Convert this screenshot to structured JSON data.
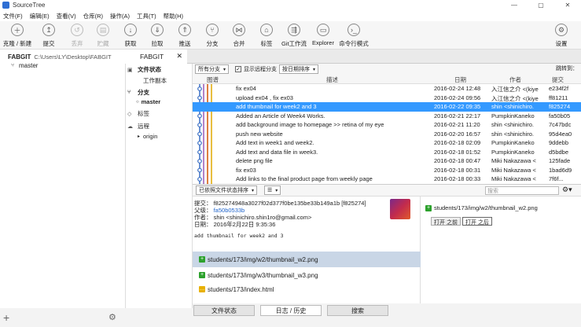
{
  "window": {
    "title": "SourceTree",
    "minimize": "—",
    "maximize": "▢",
    "close": "✕"
  },
  "menu": [
    "文件(F)",
    "编辑(E)",
    "查看(V)",
    "仓库(R)",
    "操作(A)",
    "工具(T)",
    "帮助(H)"
  ],
  "toolbar": {
    "clone": "克隆 / 新建",
    "commit": "提交",
    "discard": "丢弃",
    "stash": "贮藏",
    "fetch": "获取",
    "pull": "拉取",
    "push": "推送",
    "branch": "分支",
    "merge": "合并",
    "tag": "标签",
    "gitflow": "Git工作流",
    "explorer": "Explorer",
    "terminal": "命令行模式",
    "settings": "设置"
  },
  "repo": {
    "name": "FABGIT",
    "path": "C:\\Users\\LY\\Desktop\\FABGIT",
    "branch": "master"
  },
  "tab": {
    "label": "FABGIT",
    "close": "✕"
  },
  "nav": {
    "file_status": "文件状态",
    "working_copy": "工作副本",
    "branches": "分支",
    "master": "master",
    "tags": "标签",
    "remotes": "远程",
    "origin": "origin"
  },
  "filters": {
    "branches": "所有分支",
    "show_remote": "显示远程分支",
    "sort": "按日期排序",
    "jump_to": "跳转到："
  },
  "columns": {
    "graph": "图谱",
    "description": "描述",
    "date": "日期",
    "author": "作者",
    "commit": "提交"
  },
  "commits": [
    {
      "desc": "fix ex04",
      "date": "2016-02-24 12:48",
      "author": "入江信之介 <(kiye",
      "hash": "e234f2f"
    },
    {
      "desc": "upload ex04 , fix ex03",
      "date": "2016-02-24 09:56",
      "author": "入江信之介 <(kiye",
      "hash": "ff81211"
    },
    {
      "desc": "add thumbnail for week2 and 3",
      "date": "2016-02-22 09:35",
      "author": "shin <shinichiro.",
      "hash": "f825274"
    },
    {
      "desc": "Added an Article of Week4 Works.",
      "date": "2016-02-21 22:17",
      "author": "PumpkinKaneko",
      "hash": "fa50b05"
    },
    {
      "desc": "add background image to homepage >> retina of my eye",
      "date": "2016-02-21 11:20",
      "author": "shin <shinichiro.",
      "hash": "7c47bdc"
    },
    {
      "desc": "push new website",
      "date": "2016-02-20 16:57",
      "author": "shin <shinichiro.",
      "hash": "95d4ea0"
    },
    {
      "desc": "Add text in week1 and week2.",
      "date": "2016-02-18 02:09",
      "author": "PumpkinKaneko",
      "hash": "9ddebb"
    },
    {
      "desc": "Add text and data file in week3.",
      "date": "2016-02-18 01:52",
      "author": "PumpkinKaneko",
      "hash": "d5bdbe"
    },
    {
      "desc": "delete png file",
      "date": "2016-02-18 00:47",
      "author": "Miki Nakazawa <",
      "hash": "125fade"
    },
    {
      "desc": "fix ex03",
      "date": "2016-02-18 00:31",
      "author": "Miki Nakazawa <",
      "hash": "1bad6d9"
    },
    {
      "desc": "Add links to the final product page from weekly page",
      "date": "2016-02-18 00:33",
      "author": "Miki Nakazawa <",
      "hash": "7f6f..."
    }
  ],
  "bottom_controls": {
    "sort": "已依照文件状态排序",
    "list": "☰",
    "search_placeholder": "搜索"
  },
  "commit_detail": {
    "commit_label": "提交：",
    "commit_value": "f825274948a3027f02d377f0be135be33b149a1b [f825274]",
    "parent_label": "父级：",
    "parent_value": "fa50b0533b",
    "author_label": "作者：",
    "author_value": "shin <shinichiro.shin1ro@gmail.com>",
    "date_label": "日期：",
    "date_value": "2016年2月22日 9:35:36",
    "message": "add thumbnail for week2 and 3"
  },
  "files": [
    {
      "path": "students/173/img/w2/thumbnail_w2.png",
      "status": "added"
    },
    {
      "path": "students/173/img/w3/thumbnail_w3.png",
      "status": "added"
    },
    {
      "path": "students/173/index.html",
      "status": "modified"
    }
  ],
  "diff": {
    "file": "students/173/img/w2/thumbnail_w2.png",
    "before": "打开 之前",
    "after": "打开 之后"
  },
  "bottom_tabs": {
    "file_status": "文件状态",
    "log": "日志 / 历史",
    "search": "搜索"
  }
}
